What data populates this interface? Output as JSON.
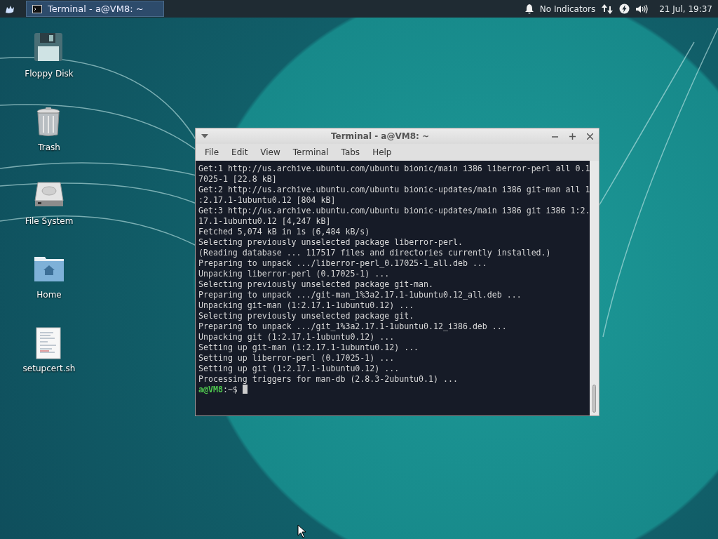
{
  "panel": {
    "task": {
      "title": "Terminal - a@VM8: ~",
      "selected": true
    },
    "indicators": "No Indicators",
    "clock": "21 Jul, 19:37"
  },
  "desktop_icons": [
    {
      "kind": "floppy",
      "label": "Floppy Disk"
    },
    {
      "kind": "trash",
      "label": "Trash"
    },
    {
      "kind": "drive",
      "label": "File System"
    },
    {
      "kind": "home",
      "label": "Home"
    },
    {
      "kind": "script",
      "label": "setupcert.sh"
    }
  ],
  "terminal": {
    "title": "Terminal - a@VM8: ~",
    "menu": [
      "File",
      "Edit",
      "View",
      "Terminal",
      "Tabs",
      "Help"
    ],
    "lines": [
      "Get:1 http://us.archive.ubuntu.com/ubuntu bionic/main i386 liberror-perl all 0.1",
      "7025-1 [22.8 kB]",
      "Get:2 http://us.archive.ubuntu.com/ubuntu bionic-updates/main i386 git-man all 1",
      ":2.17.1-1ubuntu0.12 [804 kB]",
      "Get:3 http://us.archive.ubuntu.com/ubuntu bionic-updates/main i386 git i386 1:2.",
      "17.1-1ubuntu0.12 [4,247 kB]",
      "Fetched 5,074 kB in 1s (6,484 kB/s)",
      "Selecting previously unselected package liberror-perl.",
      "(Reading database ... 117517 files and directories currently installed.)",
      "Preparing to unpack .../liberror-perl_0.17025-1_all.deb ...",
      "Unpacking liberror-perl (0.17025-1) ...",
      "Selecting previously unselected package git-man.",
      "Preparing to unpack .../git-man_1%3a2.17.1-1ubuntu0.12_all.deb ...",
      "Unpacking git-man (1:2.17.1-1ubuntu0.12) ...",
      "Selecting previously unselected package git.",
      "Preparing to unpack .../git_1%3a2.17.1-1ubuntu0.12_i386.deb ...",
      "Unpacking git (1:2.17.1-1ubuntu0.12) ...",
      "Setting up git-man (1:2.17.1-1ubuntu0.12) ...",
      "Setting up liberror-perl (0.17025-1) ...",
      "Setting up git (1:2.17.1-1ubuntu0.12) ...",
      "Processing triggers for man-db (2.8.3-2ubuntu0.1) ..."
    ],
    "prompt": {
      "user": "a@VM8",
      "path": ":~$"
    }
  }
}
